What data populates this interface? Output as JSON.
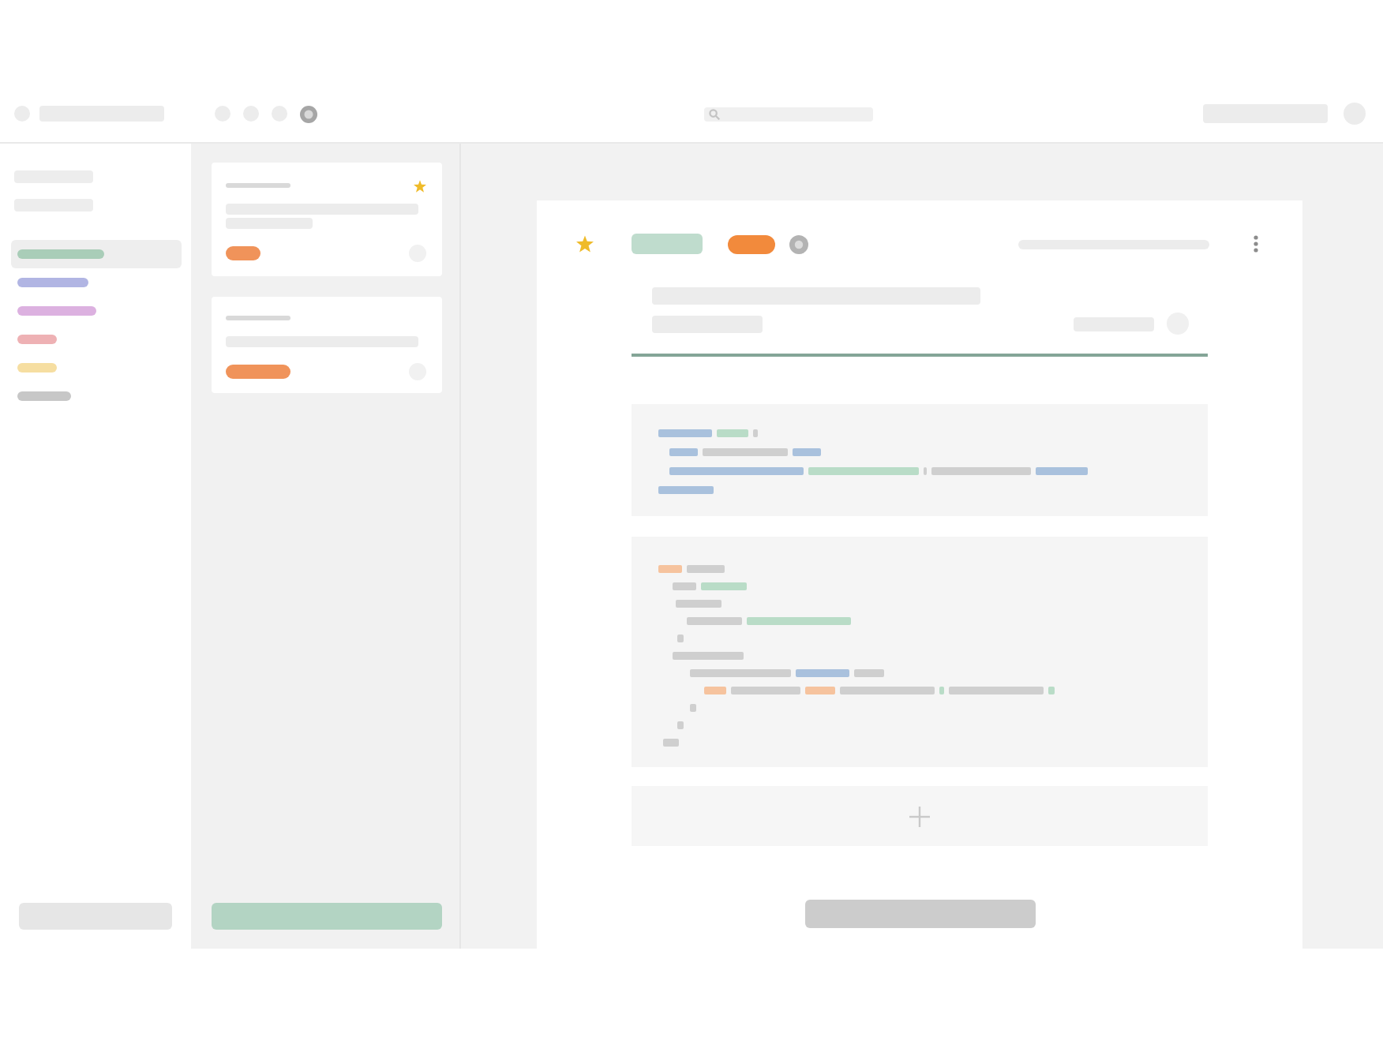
{
  "sidebar": {
    "items": [
      {
        "color": "#a9cdb8",
        "selected": true
      },
      {
        "color": "#b1b5e3",
        "selected": false
      },
      {
        "color": "#dcb1e0",
        "selected": false
      },
      {
        "color": "#eeb1b4",
        "selected": false
      },
      {
        "color": "#f6dea1",
        "selected": false
      },
      {
        "color": "#c7c7c7",
        "selected": false
      }
    ]
  },
  "cards": [
    {
      "starred": true
    },
    {
      "starred": false
    }
  ],
  "document": {
    "starred": true,
    "tags": [
      {
        "color": "#bfdccd"
      },
      {
        "color": "#f28a3c"
      }
    ]
  }
}
